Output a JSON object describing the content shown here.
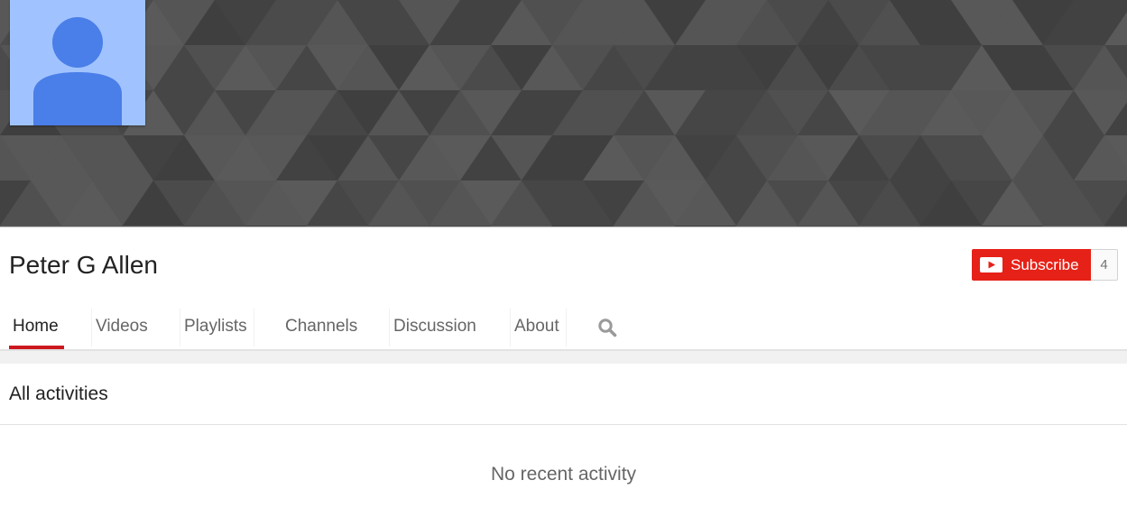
{
  "channel": {
    "name": "Peter G Allen",
    "subscribe_label": "Subscribe",
    "subscriber_count": "4"
  },
  "tabs": [
    {
      "label": "Home",
      "active": true
    },
    {
      "label": "Videos",
      "active": false
    },
    {
      "label": "Playlists",
      "active": false
    },
    {
      "label": "Channels",
      "active": false
    },
    {
      "label": "Discussion",
      "active": false
    },
    {
      "label": "About",
      "active": false
    }
  ],
  "section": {
    "title": "All activities",
    "empty_message": "No recent activity"
  },
  "icons": {
    "avatar": "default-user-silhouette",
    "subscribe": "youtube-play-icon",
    "search": "search-icon"
  },
  "colors": {
    "banner": "#4f4f4f",
    "avatar_background": "#a0c3ff",
    "avatar_figure": "#4a7ee8",
    "subscribe_button": "#e62117",
    "active_tab_underline": "#cc181e"
  }
}
